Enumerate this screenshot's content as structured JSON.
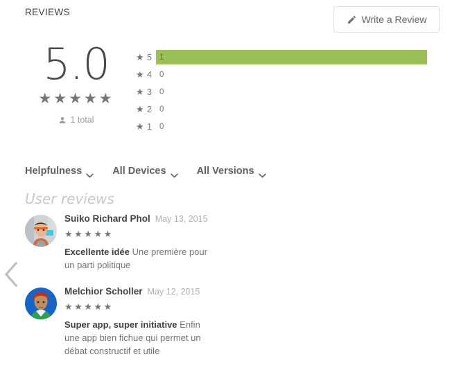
{
  "header": {
    "section_title": "REVIEWS",
    "write_review_label": "Write a Review",
    "write_review_icon": "pencil-icon"
  },
  "summary": {
    "score": "5.0",
    "score_stars": "★★★★★",
    "total_label": "1 total",
    "total_icon": "person-icon",
    "bar_color": "#9cbf56"
  },
  "histogram": {
    "rows": [
      {
        "star_glyph": "★",
        "stars": "5",
        "count": "1",
        "percent": 100
      },
      {
        "star_glyph": "★",
        "stars": "4",
        "count": "0",
        "percent": 0
      },
      {
        "star_glyph": "★",
        "stars": "3",
        "count": "0",
        "percent": 0
      },
      {
        "star_glyph": "★",
        "stars": "2",
        "count": "0",
        "percent": 0
      },
      {
        "star_glyph": "★",
        "stars": "1",
        "count": "0",
        "percent": 0
      }
    ]
  },
  "filters": [
    {
      "label": "Helpfulness",
      "icon": "chevron-down-icon"
    },
    {
      "label": "All Devices",
      "icon": "chevron-down-icon"
    },
    {
      "label": "All Versions",
      "icon": "chevron-down-icon"
    }
  ],
  "reviews_heading": "User reviews",
  "reviews": [
    {
      "author": "Suiko Richard Phol",
      "date": "May 13, 2015",
      "stars": "★★★★★",
      "body_title": "Excellente idée",
      "body_text": "Une première pour un parti politique",
      "avatar": "photo-avatar"
    },
    {
      "author": "Melchior Scholler",
      "date": "May 12, 2015",
      "stars": "★★★★★",
      "body_title": "Super app, super initiative",
      "body_text": "Enfin une app bien fichue qui permet un débat constructif et utile",
      "avatar": "illustrated-avatar"
    }
  ],
  "nav": {
    "prev_icon": "chevron-left-icon"
  }
}
